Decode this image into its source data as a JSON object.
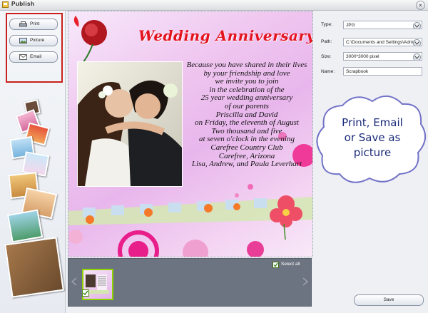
{
  "window": {
    "title": "Publish",
    "close_glyph": "×"
  },
  "left": {
    "buttons": [
      {
        "label": "Print",
        "icon": "printer-icon"
      },
      {
        "label": "Picture",
        "icon": "picture-icon"
      },
      {
        "label": "Email",
        "icon": "envelope-icon"
      }
    ],
    "highlight_color": "#c8201a"
  },
  "card": {
    "title": "Wedding Anniversary",
    "lines": [
      "Because you have shared in their lives",
      "by your friendship and love",
      "we invite you to join",
      "in the celebration of the",
      "25 year wedding anniversary",
      "of our parents",
      "Priscilla and David",
      "on Friday, the eleventh of August",
      "Two thousand and five",
      "at seven o'clock in the evening",
      "Carefree Country Club",
      "Carefree, Arizona",
      "Lisa, Andrew, and Paula Leverhart"
    ]
  },
  "settings": {
    "type_label": "Type:",
    "type_value": "JPG",
    "path_label": "Path:",
    "path_value": "C:\\Documents and Settings\\Admi",
    "size_label": "Size:",
    "size_value": "3000*3000 pixel",
    "name_label": "Name:",
    "name_value": "Scrapbook"
  },
  "callout": {
    "lines": [
      "Print, Email",
      "or Save as",
      "picture"
    ]
  },
  "thumbbar": {
    "select_all_label": "Select all"
  },
  "save_label": "Save"
}
